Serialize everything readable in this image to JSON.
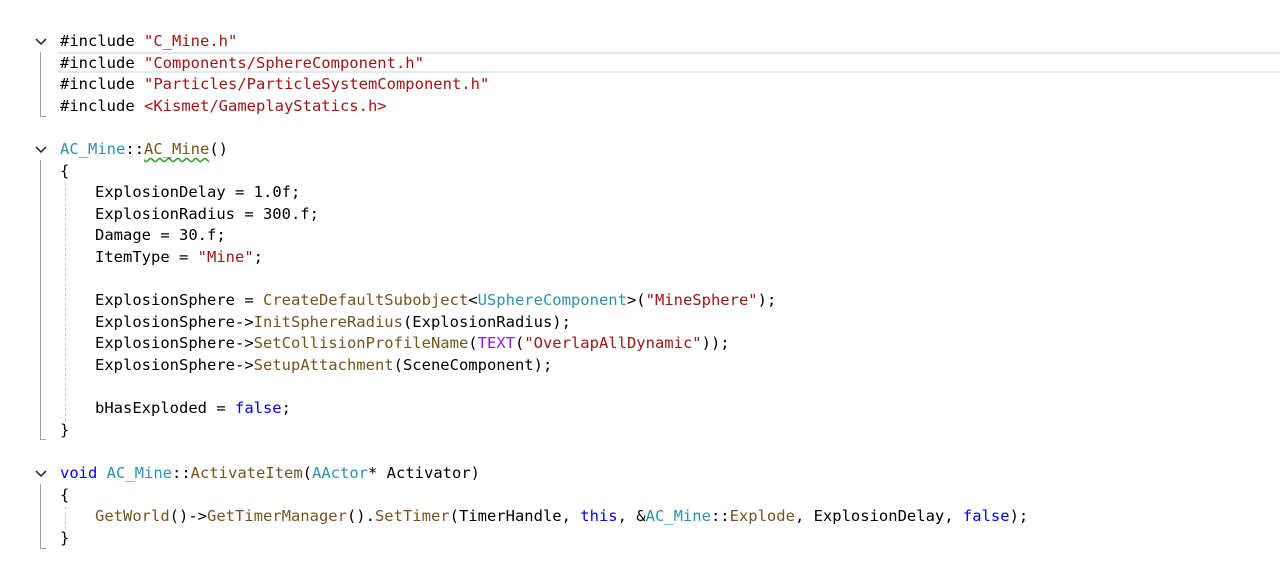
{
  "editor": {
    "lines": {
      "inc1": {
        "kw": "#include",
        "path": "\"C_Mine.h\""
      },
      "inc2": {
        "kw": "#include",
        "path": "\"Components/SphereComponent.h\""
      },
      "inc3": {
        "kw": "#include",
        "path": "\"Particles/ParticleSystemComponent.h\""
      },
      "inc4": {
        "kw": "#include",
        "path": "<Kismet/GameplayStatics.h>"
      },
      "ctor_sig": {
        "cls": "AC_Mine",
        "sep": "::",
        "name": "AC_Mine",
        "rest": "()"
      },
      "ctor_open": "{",
      "l7": {
        "id": "ExplosionDelay",
        "rest": " = 1.0f;"
      },
      "l8": {
        "id": "ExplosionRadius",
        "rest": " = 300.f;"
      },
      "l9": {
        "id": "Damage",
        "rest": " = 30.f;"
      },
      "l10": {
        "id": "ItemType",
        "eq": " = ",
        "str": "\"Mine\"",
        "end": ";"
      },
      "l12": {
        "id": "ExplosionSphere",
        "eq": " = ",
        "fn": "CreateDefaultSubobject",
        "lt": "<",
        "type": "USphereComponent",
        "gt": ">(",
        "str": "\"MineSphere\"",
        "end": ");"
      },
      "l13": {
        "id": "ExplosionSphere",
        "arrow": "->",
        "fn": "InitSphereRadius",
        "rest": "(ExplosionRadius);"
      },
      "l14": {
        "id": "ExplosionSphere",
        "arrow": "->",
        "fn": "SetCollisionProfileName",
        "p1": "(",
        "mac": "TEXT",
        "p2": "(",
        "str": "\"OverlapAllDynamic\"",
        "end": "));"
      },
      "l15": {
        "id": "ExplosionSphere",
        "arrow": "->",
        "fn": "SetupAttachment",
        "rest": "(SceneComponent);"
      },
      "l17": {
        "id": "bHasExploded",
        "eq": " = ",
        "kw": "false",
        "end": ";"
      },
      "ctor_close": "}",
      "act_sig": {
        "kw": "void",
        "cls": "AC_Mine",
        "sep": "::",
        "fn": "ActivateItem",
        "p1": "(",
        "type": "AActor",
        "rest": "* Activator)"
      },
      "act_open": "{",
      "l21": {
        "fn1": "GetWorld",
        "m1": "()->",
        "fn2": "GetTimerManager",
        "m2": "().",
        "fn3": "SetTimer",
        "m3": "(TimerHandle, ",
        "kw1": "this",
        "m4": ", &",
        "cls": "AC_Mine",
        "sep": "::",
        "fn4": "Explode",
        "m5": ", ExplosionDelay, ",
        "kw2": "false",
        "end": ");"
      },
      "act_close": "}"
    }
  },
  "colors": {
    "keyword": "#0000ff",
    "string": "#a31515",
    "type": "#2b91af",
    "function": "#74531f",
    "macro": "#8a1bff",
    "background": "#ffffff"
  },
  "icons": [
    "fold-chevron-icon"
  ]
}
